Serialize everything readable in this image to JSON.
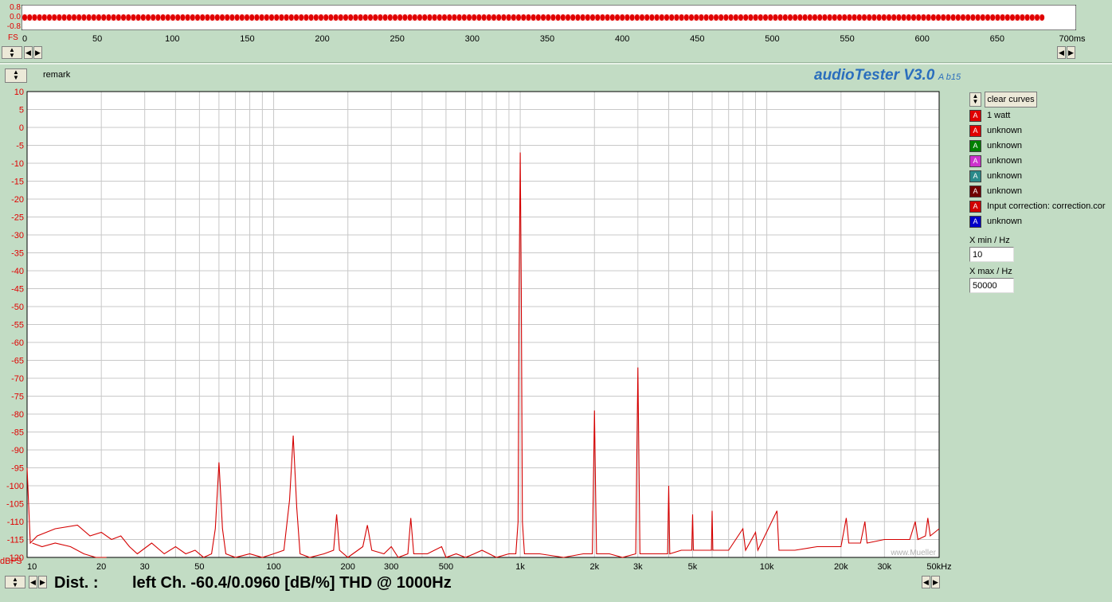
{
  "colors": {
    "background": "#c2dcc4",
    "trace": "#d40000",
    "axis_labels": "#e00000",
    "logo": "#2a6ebd",
    "grid": "#c8c8c8"
  },
  "top_panel": {
    "y_labels": [
      "0.8",
      "0.0",
      "-0.8"
    ],
    "fs_label": "FS",
    "x_ticks": [
      "0",
      "50",
      "100",
      "150",
      "200",
      "250",
      "300",
      "350",
      "400",
      "450",
      "500",
      "550",
      "600",
      "650",
      "700ms"
    ],
    "signal_end_ms": 680
  },
  "remark_label": "remark",
  "logo": {
    "title": "audioTester V3.0",
    "version": "A b15"
  },
  "spectrum": {
    "y_unit": "dBFS",
    "y_ticks": [
      "10",
      "5",
      "0",
      "-5",
      "-10",
      "-15",
      "-20",
      "-25",
      "-30",
      "-35",
      "-40",
      "-45",
      "-50",
      "-55",
      "-60",
      "-65",
      "-70",
      "-75",
      "-80",
      "-85",
      "-90",
      "-95",
      "-100",
      "-105",
      "-110",
      "-115",
      "-120"
    ],
    "x_ticks": [
      {
        "f": 10,
        "label": "10"
      },
      {
        "f": 20,
        "label": "20"
      },
      {
        "f": 30,
        "label": "30"
      },
      {
        "f": 50,
        "label": "50"
      },
      {
        "f": 100,
        "label": "100"
      },
      {
        "f": 200,
        "label": "200"
      },
      {
        "f": 300,
        "label": "300"
      },
      {
        "f": 500,
        "label": "500"
      },
      {
        "f": 1000,
        "label": "1k"
      },
      {
        "f": 2000,
        "label": "2k"
      },
      {
        "f": 3000,
        "label": "3k"
      },
      {
        "f": 5000,
        "label": "5k"
      },
      {
        "f": 10000,
        "label": "10k"
      },
      {
        "f": 20000,
        "label": "20k"
      },
      {
        "f": 30000,
        "label": "30k"
      },
      {
        "f": 50000,
        "label": "50kHz"
      }
    ],
    "watermark": "www.Mueller"
  },
  "chart_data": {
    "type": "line",
    "title": "",
    "xlabel": "Hz",
    "ylabel": "dBFS",
    "x_scale": "log",
    "xlim": [
      10,
      50000
    ],
    "ylim": [
      -120,
      10
    ],
    "grid": true,
    "series": [
      {
        "name": "1 watt",
        "points": [
          [
            10,
            -95
          ],
          [
            10.3,
            -116
          ],
          [
            11,
            -114
          ],
          [
            13,
            -112
          ],
          [
            16,
            -111
          ],
          [
            18,
            -114
          ],
          [
            20,
            -113
          ],
          [
            22,
            -115
          ],
          [
            24,
            -114
          ],
          [
            26,
            -117
          ],
          [
            28,
            -119
          ],
          [
            32,
            -116
          ],
          [
            36,
            -119
          ],
          [
            40,
            -117
          ],
          [
            44,
            -119
          ],
          [
            48,
            -118
          ],
          [
            52,
            -120
          ],
          [
            56,
            -119
          ],
          [
            58,
            -112
          ],
          [
            60,
            -93.5
          ],
          [
            62,
            -112
          ],
          [
            64,
            -119
          ],
          [
            70,
            -120
          ],
          [
            80,
            -119
          ],
          [
            90,
            -120
          ],
          [
            100,
            -119
          ],
          [
            110,
            -118
          ],
          [
            116,
            -104
          ],
          [
            120,
            -86
          ],
          [
            124,
            -106
          ],
          [
            128,
            -119
          ],
          [
            140,
            -120
          ],
          [
            160,
            -119
          ],
          [
            175,
            -118
          ],
          [
            180,
            -108
          ],
          [
            185,
            -118
          ],
          [
            200,
            -120
          ],
          [
            230,
            -117
          ],
          [
            240,
            -111
          ],
          [
            250,
            -118
          ],
          [
            280,
            -119
          ],
          [
            300,
            -117
          ],
          [
            320,
            -120
          ],
          [
            350,
            -119
          ],
          [
            360,
            -109
          ],
          [
            370,
            -119
          ],
          [
            420,
            -119
          ],
          [
            480,
            -117
          ],
          [
            500,
            -120
          ],
          [
            550,
            -119
          ],
          [
            600,
            -120
          ],
          [
            650,
            -119
          ],
          [
            700,
            -118
          ],
          [
            800,
            -120
          ],
          [
            900,
            -119
          ],
          [
            960,
            -119
          ],
          [
            980,
            -110
          ],
          [
            990,
            -45
          ],
          [
            1000,
            -7
          ],
          [
            1010,
            -45
          ],
          [
            1020,
            -110
          ],
          [
            1040,
            -119
          ],
          [
            1200,
            -119
          ],
          [
            1500,
            -120
          ],
          [
            1800,
            -119
          ],
          [
            1960,
            -119
          ],
          [
            1980,
            -100
          ],
          [
            2000,
            -79
          ],
          [
            2020,
            -100
          ],
          [
            2040,
            -119
          ],
          [
            2300,
            -119
          ],
          [
            2600,
            -120
          ],
          [
            2940,
            -119
          ],
          [
            2970,
            -93
          ],
          [
            3000,
            -67
          ],
          [
            3030,
            -93
          ],
          [
            3060,
            -119
          ],
          [
            3500,
            -119
          ],
          [
            3960,
            -119
          ],
          [
            4000,
            -100
          ],
          [
            4040,
            -119
          ],
          [
            4500,
            -118
          ],
          [
            4960,
            -118
          ],
          [
            5000,
            -108
          ],
          [
            5040,
            -118
          ],
          [
            5600,
            -118
          ],
          [
            5960,
            -118
          ],
          [
            6000,
            -107
          ],
          [
            6040,
            -118
          ],
          [
            7000,
            -118
          ],
          [
            8000,
            -112
          ],
          [
            8200,
            -118
          ],
          [
            9000,
            -113
          ],
          [
            9200,
            -118
          ],
          [
            11000,
            -107
          ],
          [
            11200,
            -118
          ],
          [
            13000,
            -118
          ],
          [
            16000,
            -117
          ],
          [
            20000,
            -117
          ],
          [
            21000,
            -109
          ],
          [
            21500,
            -116
          ],
          [
            24000,
            -116
          ],
          [
            25000,
            -110
          ],
          [
            25500,
            -116
          ],
          [
            30000,
            -115
          ],
          [
            35000,
            -115
          ],
          [
            38000,
            -115
          ],
          [
            40000,
            -110
          ],
          [
            41000,
            -115
          ],
          [
            44000,
            -114
          ],
          [
            45000,
            -109
          ],
          [
            46000,
            -114
          ],
          [
            48000,
            -113
          ],
          [
            50000,
            -112
          ]
        ]
      },
      {
        "name": "unknown",
        "points": [
          [
            10.5,
            -116
          ],
          [
            11.5,
            -117
          ],
          [
            13,
            -116
          ],
          [
            15,
            -117
          ],
          [
            17,
            -119
          ],
          [
            19,
            -120
          ],
          [
            21,
            -120
          ]
        ]
      }
    ]
  },
  "legend": {
    "clear_label": "clear curves",
    "btn_glyph": "A",
    "items": [
      {
        "label": "1 watt",
        "color": "#e00000"
      },
      {
        "label": "unknown",
        "color": "#e00000"
      },
      {
        "label": "unknown",
        "color": "#008000"
      },
      {
        "label": "unknown",
        "color": "#cc33cc"
      },
      {
        "label": "unknown",
        "color": "#2a8a8a"
      },
      {
        "label": "unknown",
        "color": "#700000"
      },
      {
        "label": "Input correction: correction.cor",
        "color": "#d00000"
      },
      {
        "label": "unknown",
        "color": "#0000c8"
      }
    ]
  },
  "x_min": {
    "label": "X min / Hz",
    "value": "10"
  },
  "x_max": {
    "label": "X max / Hz",
    "value": "50000"
  },
  "status": {
    "dist_label": "Dist. :",
    "message": "left Ch. -60.4/0.0960 [dB/%] THD @ 1000Hz"
  }
}
